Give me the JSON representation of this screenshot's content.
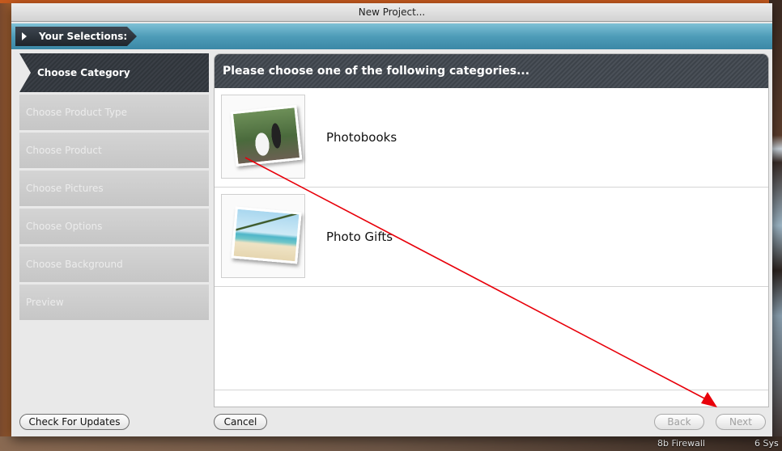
{
  "window": {
    "title": "New Project..."
  },
  "selections_bar": {
    "label": "Your Selections:"
  },
  "nav": {
    "items": [
      {
        "label": "Choose Category",
        "active": true
      },
      {
        "label": "Choose Product Type",
        "active": false
      },
      {
        "label": "Choose Product",
        "active": false
      },
      {
        "label": "Choose Pictures",
        "active": false
      },
      {
        "label": "Choose Options",
        "active": false
      },
      {
        "label": "Choose Background",
        "active": false
      },
      {
        "label": "Preview",
        "active": false
      }
    ]
  },
  "panel": {
    "header": "Please choose one of the following categories...",
    "categories": [
      {
        "label": "Photobooks",
        "icon": "wedding-photo-thumbnail"
      },
      {
        "label": "Photo Gifts",
        "icon": "beach-photo-thumbnail"
      }
    ]
  },
  "buttons": {
    "check_updates": "Check For Updates",
    "cancel": "Cancel",
    "back": "Back",
    "next": "Next"
  },
  "taskbar": {
    "item1": "8b Firewall",
    "item2": "6 Sys"
  },
  "colors": {
    "annotation_arrow": "#e8000a",
    "selections_bar": "#4e9cb8",
    "active_nav": "#34393f"
  }
}
